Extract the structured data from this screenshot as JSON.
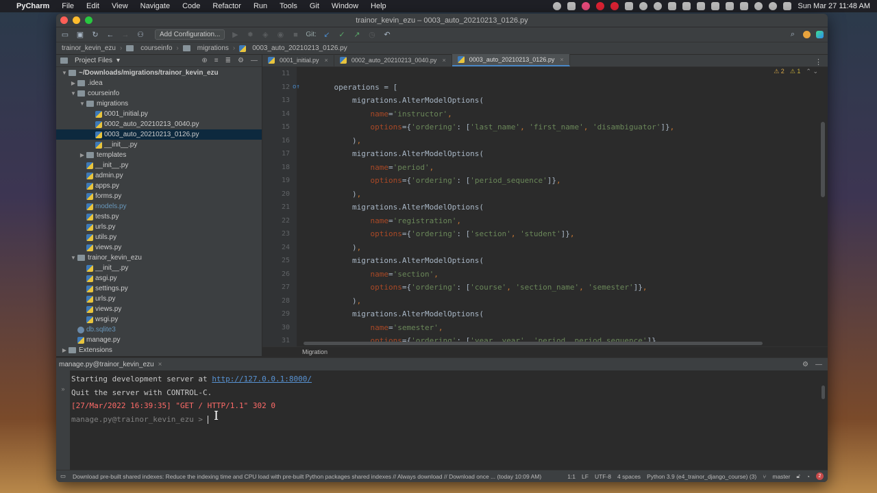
{
  "menubar": {
    "app": "PyCharm",
    "items": [
      "File",
      "Edit",
      "View",
      "Navigate",
      "Code",
      "Refactor",
      "Run",
      "Tools",
      "Git",
      "Window",
      "Help"
    ],
    "clock": "Sun Mar 27  11:48 AM"
  },
  "window": {
    "title": "trainor_kevin_ezu – 0003_auto_20210213_0126.py"
  },
  "toolbar": {
    "config_label": "Add Configuration...",
    "git_label": "Git:"
  },
  "breadcrumb": [
    "trainor_kevin_ezu",
    "courseinfo",
    "migrations",
    "0003_auto_20210213_0126.py"
  ],
  "project": {
    "header": "Project Files",
    "rows": [
      {
        "label": "~/Downloads/migrations/trainor_kevin_ezu",
        "indent": 0,
        "type": "folder",
        "arrow": "▼",
        "bold": true
      },
      {
        "label": ".idea",
        "indent": 1,
        "type": "folder",
        "arrow": "▶"
      },
      {
        "label": "courseinfo",
        "indent": 1,
        "type": "folder",
        "arrow": "▼"
      },
      {
        "label": "migrations",
        "indent": 2,
        "type": "folder",
        "arrow": "▼"
      },
      {
        "label": "0001_initial.py",
        "indent": 3,
        "type": "py"
      },
      {
        "label": "0002_auto_20210213_0040.py",
        "indent": 3,
        "type": "py"
      },
      {
        "label": "0003_auto_20210213_0126.py",
        "indent": 3,
        "type": "py",
        "selected": true
      },
      {
        "label": "__init__.py",
        "indent": 3,
        "type": "py"
      },
      {
        "label": "templates",
        "indent": 2,
        "type": "folder",
        "arrow": "▶"
      },
      {
        "label": "__init__.py",
        "indent": 2,
        "type": "py"
      },
      {
        "label": "admin.py",
        "indent": 2,
        "type": "py"
      },
      {
        "label": "apps.py",
        "indent": 2,
        "type": "py"
      },
      {
        "label": "forms.py",
        "indent": 2,
        "type": "py"
      },
      {
        "label": "models.py",
        "indent": 2,
        "type": "py",
        "color": "blue"
      },
      {
        "label": "tests.py",
        "indent": 2,
        "type": "py"
      },
      {
        "label": "urls.py",
        "indent": 2,
        "type": "py"
      },
      {
        "label": "utils.py",
        "indent": 2,
        "type": "py"
      },
      {
        "label": "views.py",
        "indent": 2,
        "type": "py"
      },
      {
        "label": "trainor_kevin_ezu",
        "indent": 1,
        "type": "folder",
        "arrow": "▼"
      },
      {
        "label": "__init__.py",
        "indent": 2,
        "type": "py"
      },
      {
        "label": "asgi.py",
        "indent": 2,
        "type": "py"
      },
      {
        "label": "settings.py",
        "indent": 2,
        "type": "py"
      },
      {
        "label": "urls.py",
        "indent": 2,
        "type": "py"
      },
      {
        "label": "views.py",
        "indent": 2,
        "type": "py"
      },
      {
        "label": "wsgi.py",
        "indent": 2,
        "type": "py"
      },
      {
        "label": "db.sqlite3",
        "indent": 1,
        "type": "db",
        "color": "blue"
      },
      {
        "label": "manage.py",
        "indent": 1,
        "type": "py"
      },
      {
        "label": "Extensions",
        "indent": 0,
        "type": "folder",
        "arrow": "▶"
      }
    ]
  },
  "tabs": [
    {
      "label": "0001_initial.py",
      "active": false
    },
    {
      "label": "0002_auto_20210213_0040.py",
      "active": false
    },
    {
      "label": "0003_auto_20210213_0126.py",
      "active": true
    }
  ],
  "inspections": {
    "warnings": "2",
    "weak": "1"
  },
  "code_lines": [
    {
      "n": "11",
      "html": ""
    },
    {
      "n": "12",
      "mark": "o↑",
      "html": "    operations = ["
    },
    {
      "n": "13",
      "html": "        migrations.AlterModelOptions("
    },
    {
      "n": "14",
      "html": "            <span class=\"param\">name</span>=<span class=\"str\">'instructor'</span><span class=\"punc\">,</span>"
    },
    {
      "n": "15",
      "html": "            <span class=\"param\">options</span>={<span class=\"str\">'ordering'</span>: [<span class=\"str\">'last_name'</span><span class=\"punc\">,</span> <span class=\"str\">'first_name'</span><span class=\"punc\">,</span> <span class=\"str\">'disambiguator'</span>]}<span class=\"punc\">,</span>"
    },
    {
      "n": "16",
      "html": "        )<span class=\"punc\">,</span>"
    },
    {
      "n": "17",
      "html": "        migrations.AlterModelOptions("
    },
    {
      "n": "18",
      "html": "            <span class=\"param\">name</span>=<span class=\"str\">'period'</span><span class=\"punc\">,</span>"
    },
    {
      "n": "19",
      "html": "            <span class=\"param\">options</span>={<span class=\"str\">'ordering'</span>: [<span class=\"str\">'period_sequence'</span>]}<span class=\"punc\">,</span>"
    },
    {
      "n": "20",
      "html": "        )<span class=\"punc\">,</span>"
    },
    {
      "n": "21",
      "html": "        migrations.AlterModelOptions("
    },
    {
      "n": "22",
      "html": "            <span class=\"param\">name</span>=<span class=\"str\">'registration'</span><span class=\"punc\">,</span>"
    },
    {
      "n": "23",
      "html": "            <span class=\"param\">options</span>={<span class=\"str\">'ordering'</span>: [<span class=\"str\">'section'</span><span class=\"punc\">,</span> <span class=\"str\">'student'</span>]}<span class=\"punc\">,</span>"
    },
    {
      "n": "24",
      "html": "        )<span class=\"punc\">,</span>"
    },
    {
      "n": "25",
      "html": "        migrations.AlterModelOptions("
    },
    {
      "n": "26",
      "html": "            <span class=\"param\">name</span>=<span class=\"str\">'section'</span><span class=\"punc\">,</span>"
    },
    {
      "n": "27",
      "html": "            <span class=\"param\">options</span>={<span class=\"str\">'ordering'</span>: [<span class=\"str\">'course'</span><span class=\"punc\">,</span> <span class=\"str\">'section_name'</span><span class=\"punc\">,</span> <span class=\"str\">'semester'</span>]}<span class=\"punc\">,</span>"
    },
    {
      "n": "28",
      "html": "        )<span class=\"punc\">,</span>"
    },
    {
      "n": "29",
      "html": "        migrations.AlterModelOptions("
    },
    {
      "n": "30",
      "html": "            <span class=\"param\">name</span>=<span class=\"str\">'semester'</span><span class=\"punc\">,</span>"
    },
    {
      "n": "31",
      "html": "            <span class=\"param\">options</span>={<span class=\"str\">'ordering'</span>: [<span class=\"str\">'year__year'</span><span class=\"punc\">,</span> <span class=\"str\">'period__period_sequence'</span>]}<span class=\"punc\">,</span>"
    }
  ],
  "editor_status": "Migration",
  "run": {
    "title": "manage.py@trainor_kevin_ezu",
    "lines": [
      {
        "text": "Starting development server at ",
        "link": "http://127.0.0.1:8000/",
        "kind": "normal"
      },
      {
        "text": "Quit the server with CONTROL-C.",
        "kind": "normal"
      },
      {
        "text": "[27/Mar/2022 16:39:35] \"GET / HTTP/1.1\" 302 0",
        "kind": "err"
      },
      {
        "text": "manage.py@trainor_kevin_ezu > ",
        "kind": "prompt"
      }
    ]
  },
  "status": {
    "message": "Download pre-built shared indexes: Reduce the indexing time and CPU load with pre-built Python packages shared indexes // Always download // Download once ... (today 10:09 AM)",
    "position": "1:1",
    "line_sep": "LF",
    "encoding": "UTF-8",
    "indent": "4 spaces",
    "interpreter": "Python 3.9 (e4_trainor_django_course) (3)",
    "branch": "master",
    "errors": "2"
  }
}
